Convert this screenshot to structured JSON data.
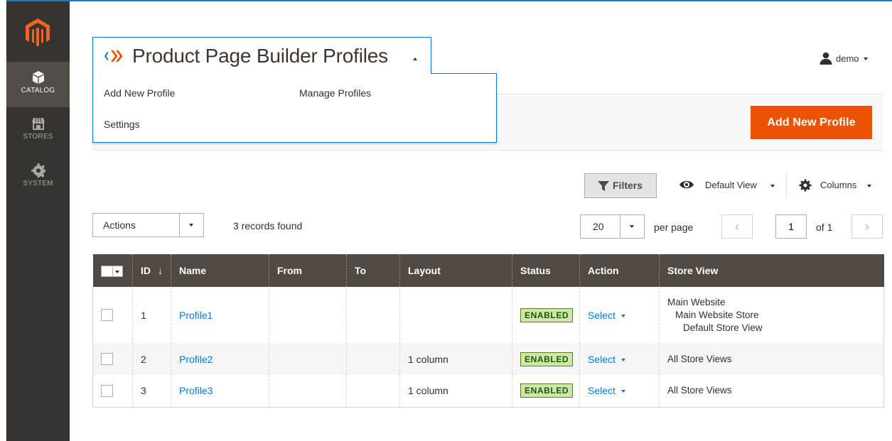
{
  "header": {
    "page_title": "Product Page Builder Profiles",
    "user_name": "demo"
  },
  "sidebar": {
    "items": [
      {
        "label": "CATALOG",
        "icon": "box-icon",
        "active": true
      },
      {
        "label": "STORES",
        "icon": "storefront-icon",
        "active": false
      },
      {
        "label": "SYSTEM",
        "icon": "gear-icon",
        "active": false
      }
    ]
  },
  "dropdown_menu": {
    "add_new_profile": "Add New Profile",
    "manage_profiles": "Manage Profiles",
    "settings": "Settings"
  },
  "toolbar": {
    "add_button": "Add New Profile",
    "filters_label": "Filters",
    "view_label": "Default View",
    "columns_label": "Columns"
  },
  "grid_controls": {
    "actions_label": "Actions",
    "records_found": "3 records found",
    "per_page_value": "20",
    "per_page_label": "per page",
    "page_current": "1",
    "page_of": "of 1"
  },
  "table": {
    "columns": [
      "ID",
      "Name",
      "From",
      "To",
      "Layout",
      "Status",
      "Action",
      "Store View"
    ],
    "sort_indicator": "↓",
    "rows": [
      {
        "id": "1",
        "name": "Profile1",
        "from": "",
        "to": "",
        "layout": "",
        "status": "ENABLED",
        "action": "Select",
        "store_view": [
          "Main Website",
          "Main Website Store",
          "Default Store View"
        ]
      },
      {
        "id": "2",
        "name": "Profile2",
        "from": "",
        "to": "",
        "layout": "1 column",
        "status": "ENABLED",
        "action": "Select",
        "store_view": [
          "All Store Views"
        ]
      },
      {
        "id": "3",
        "name": "Profile3",
        "from": "",
        "to": "",
        "layout": "1 column",
        "status": "ENABLED",
        "action": "Select",
        "store_view": [
          "All Store Views"
        ]
      }
    ]
  },
  "colors": {
    "accent_orange": "#eb5202",
    "sidebar_bg": "#373330",
    "table_header_bg": "#514943",
    "link_blue": "#007bdb",
    "status_green_bg": "#d0e5a9"
  }
}
